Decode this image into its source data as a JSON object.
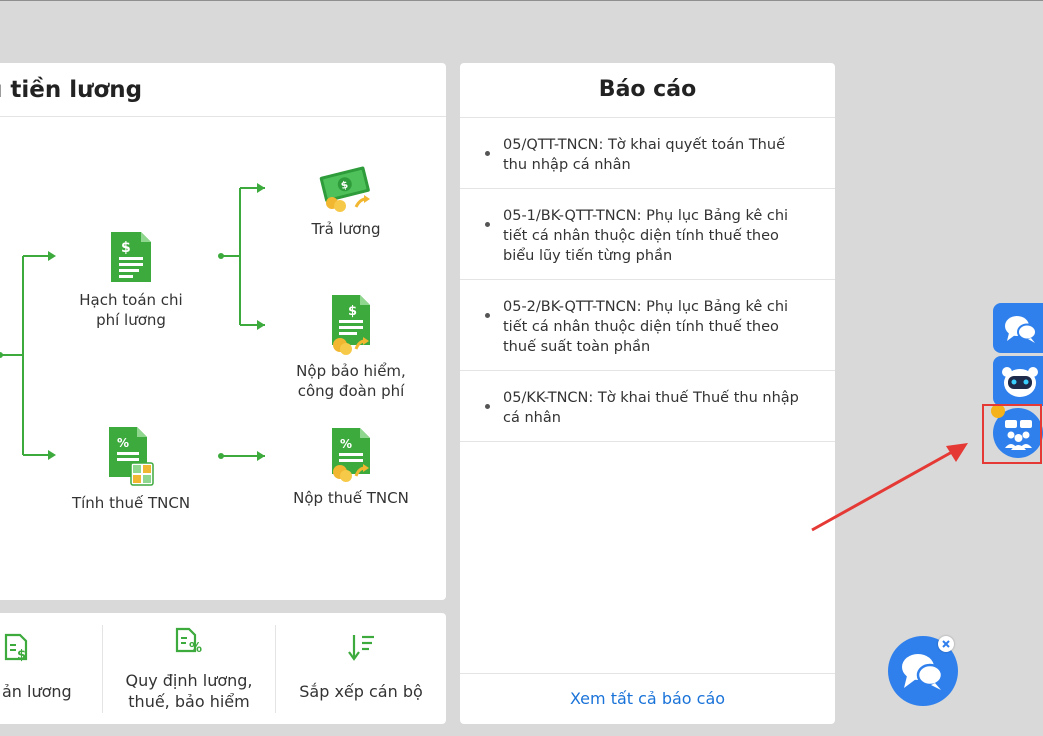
{
  "process": {
    "title": "ụ tiền lương",
    "nodes": {
      "payroll": "Hạch toán chi phí lương",
      "pay_salary": "Trả lương",
      "insurance": "Nộp bảo hiểm, công đoàn phí",
      "pit_calc": "Tính thuế TNCN",
      "pit_pay": "Nộp thuế TNCN"
    }
  },
  "shortcuts": {
    "salary": "ản lương",
    "rules": "Quy định lương, thuế, bảo hiểm",
    "arrange": "Sắp xếp cán bộ"
  },
  "reports": {
    "title": "Báo cáo",
    "items": [
      "05/QTT-TNCN: Tờ khai quyết toán Thuế thu nhập cá nhân",
      "05-1/BK-QTT-TNCN: Phụ lục Bảng kê chi tiết cá nhân thuộc diện tính thuế theo biểu lũy tiến từng phần",
      "05-2/BK-QTT-TNCN: Phụ lục Bảng kê chi tiết cá nhân thuộc diện tính thuế theo thuế suất toàn phần",
      "05/KK-TNCN: Tờ khai thuế Thuế thu nhập cá nhân"
    ],
    "view_all": "Xem tất cả báo cáo"
  },
  "colors": {
    "accent_green": "#3daa3d",
    "link_blue": "#1a73d9",
    "button_blue": "#2f80ed",
    "highlight_red": "#e53935"
  }
}
